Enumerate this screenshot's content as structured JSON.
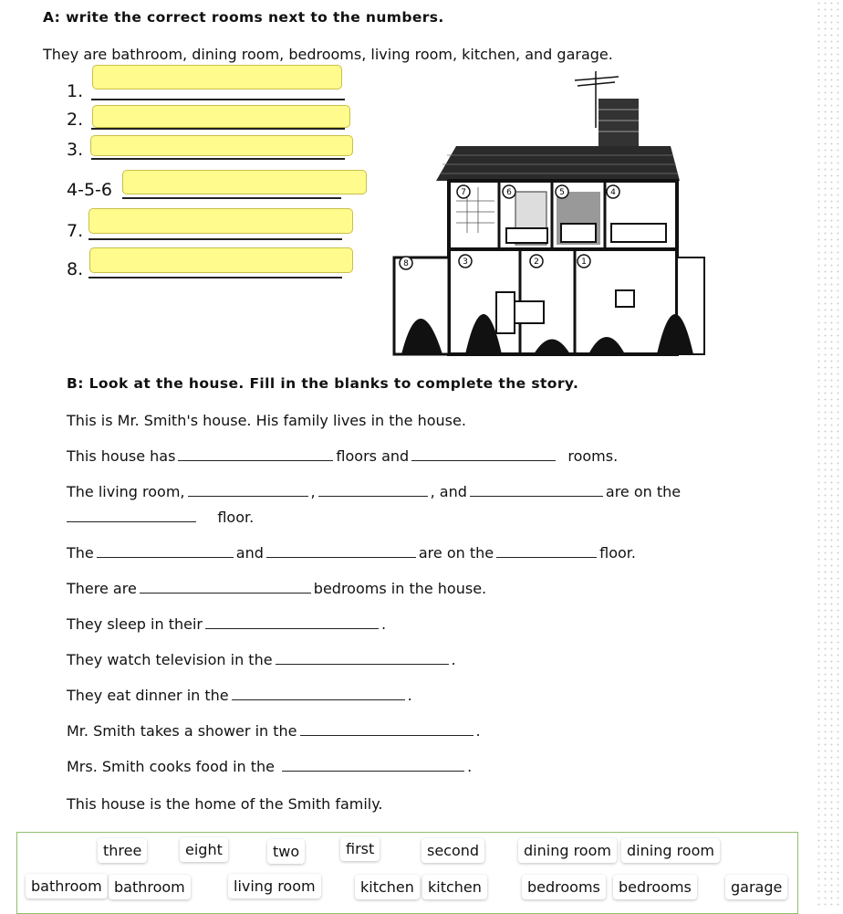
{
  "section_a": {
    "title": "A: write the correct rooms next to the numbers.",
    "intro": "They are bathroom, dining room, bedrooms, living room, kitchen, and garage.",
    "items": [
      {
        "label": "1.",
        "value": ""
      },
      {
        "label": "2.",
        "value": ""
      },
      {
        "label": "3.",
        "value": ""
      },
      {
        "label": "4-5-6",
        "value": ""
      },
      {
        "label": "7.",
        "value": ""
      },
      {
        "label": "8.",
        "value": ""
      }
    ]
  },
  "house_image": {
    "description": "Cutaway drawing of a two-floor house with numbered rooms",
    "room_numbers": [
      "7",
      "6",
      "5",
      "4",
      "3",
      "2",
      "1",
      "8"
    ]
  },
  "section_b": {
    "title": "B: Look at the house. Fill in the blanks to complete the story.",
    "lines": {
      "l1": "This is Mr. Smith's house. His family lives in the house.",
      "l2a": "This house has",
      "l2b": "floors and",
      "l2c": "rooms.",
      "l3a": "The living room,",
      "l3b": ",",
      "l3c": ", and",
      "l3d": "are on the",
      "l3e": "floor.",
      "l4a": "The",
      "l4b": "and",
      "l4c": "are on the",
      "l4d": "floor.",
      "l5a": "There are",
      "l5b": "bedrooms in the house.",
      "l6a": "They sleep in their",
      "l6b": ".",
      "l7a": "They watch television in the",
      "l7b": ".",
      "l8a": "They eat dinner in the",
      "l8b": ".",
      "l9a": "Mr. Smith takes a shower in the",
      "l9b": ".",
      "l10a": "Mrs. Smith cooks food in the",
      "l10b": ".",
      "l11": "This house is the home of the Smith family."
    }
  },
  "word_bank": {
    "row1": [
      "three",
      "eight",
      "two",
      "first",
      "second",
      "dining room",
      "dining room"
    ],
    "row2": [
      "bathroom",
      "bathroom",
      "living room",
      "kitchen",
      "kitchen",
      "bedrooms",
      "bedrooms",
      "garage"
    ]
  }
}
